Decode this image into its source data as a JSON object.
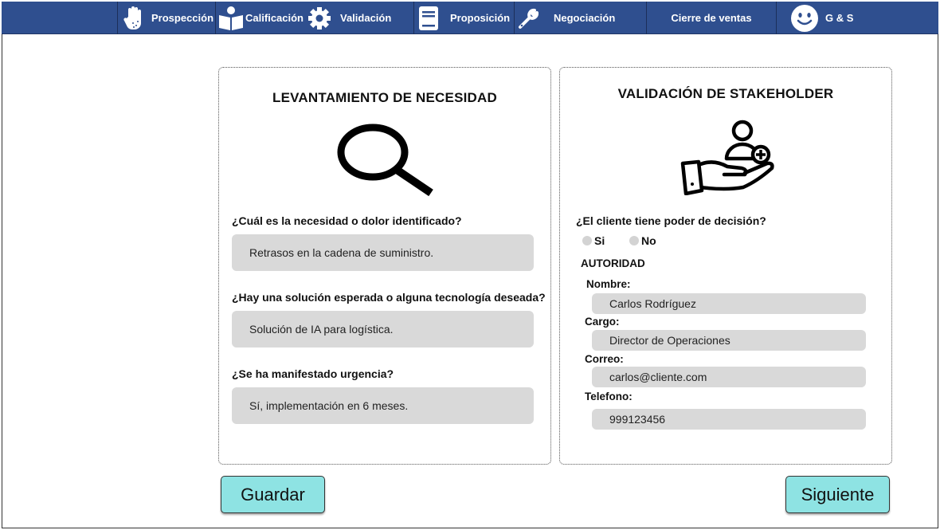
{
  "nav": {
    "items": [
      {
        "label": "Prospección",
        "icon": "hand-icon"
      },
      {
        "label": "Calificación",
        "icon": "book-reader-icon"
      },
      {
        "label": "Validación",
        "icon": "gear-icon"
      },
      {
        "label": "Proposición",
        "icon": "book-icon"
      },
      {
        "label": "Negociación",
        "icon": "wrench-icon"
      },
      {
        "label": "Cierre de ventas",
        "icon": ""
      },
      {
        "label": "G & S",
        "icon": "smiley-icon"
      }
    ],
    "bg_color": "#2f4f8f"
  },
  "left_card": {
    "title": "LEVANTAMIENTO DE NECESIDAD",
    "icon": "magnifier-icon",
    "questions": [
      {
        "label": "¿Cuál es la necesidad o dolor identificado?",
        "answer": "Retrasos en la cadena de suministro."
      },
      {
        "label": "¿Hay una solución esperada o alguna tecnología deseada?",
        "answer": "Solución de IA para logística."
      },
      {
        "label": "¿Se ha manifestado urgencia?",
        "answer": "Sí, implementación en 6 meses."
      }
    ]
  },
  "right_card": {
    "title": "VALIDACIÓN DE STAKEHOLDER",
    "icon": "hand-add-user-icon",
    "decision_question": "¿El cliente tiene poder de decisión?",
    "options": [
      "Si",
      "No"
    ],
    "section": "AUTORIDAD",
    "fields": [
      {
        "label": "Nombre:",
        "value": "Carlos Rodríguez"
      },
      {
        "label": "Cargo:",
        "value": "Director de Operaciones"
      },
      {
        "label": "Correo:",
        "value": "carlos@cliente.com"
      },
      {
        "label": "Telefono:",
        "value": "999123456"
      }
    ]
  },
  "buttons": {
    "save": "Guardar",
    "next": "Siguiente",
    "color": "#8ee3e3"
  }
}
